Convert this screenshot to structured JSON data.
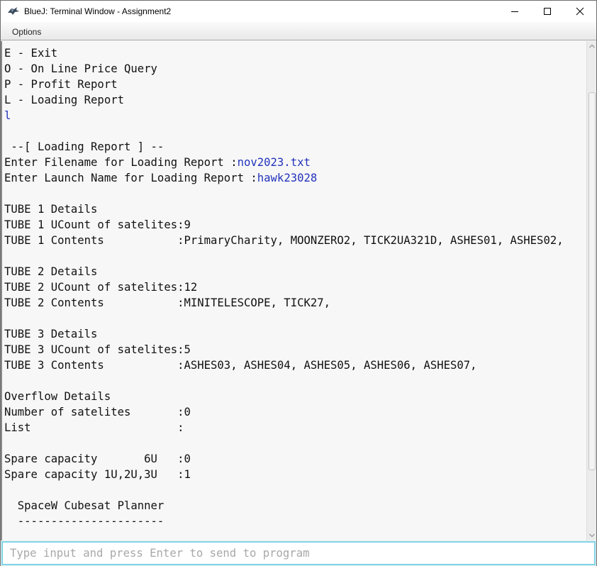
{
  "window": {
    "title": "BlueJ: Terminal Window - Assignment2",
    "app_icon": "bluej-bird-icon",
    "controls": [
      "minimize-icon",
      "maximize-icon",
      "close-icon"
    ]
  },
  "menubar": {
    "items": [
      {
        "label": "Options"
      }
    ]
  },
  "terminal": {
    "lines": [
      {
        "text": "E - Exit"
      },
      {
        "text": "O - On Line Price Query"
      },
      {
        "text": "P - Profit Report"
      },
      {
        "text": "L - Loading Report"
      },
      {
        "text": "",
        "input": "l"
      },
      {
        "text": ""
      },
      {
        "text": " --[ Loading Report ] --"
      },
      {
        "text": "Enter Filename for Loading Report :",
        "input": "nov2023.txt"
      },
      {
        "text": "Enter Launch Name for Loading Report :",
        "input": "hawk23028"
      },
      {
        "text": ""
      },
      {
        "text": "TUBE 1 Details"
      },
      {
        "text": "TUBE 1 UCount of satelites:9"
      },
      {
        "text": "TUBE 1 Contents           :PrimaryCharity, MOONZERO2, TICK2UA321D, ASHES01, ASHES02,"
      },
      {
        "text": ""
      },
      {
        "text": "TUBE 2 Details"
      },
      {
        "text": "TUBE 2 UCount of satelites:12"
      },
      {
        "text": "TUBE 2 Contents           :MINITELESCOPE, TICK27,"
      },
      {
        "text": ""
      },
      {
        "text": "TUBE 3 Details"
      },
      {
        "text": "TUBE 3 UCount of satelites:5"
      },
      {
        "text": "TUBE 3 Contents           :ASHES03, ASHES04, ASHES05, ASHES06, ASHES07,"
      },
      {
        "text": ""
      },
      {
        "text": "Overflow Details"
      },
      {
        "text": "Number of satelites       :0"
      },
      {
        "text": "List                      :"
      },
      {
        "text": ""
      },
      {
        "text": "Spare capacity       6U   :0"
      },
      {
        "text": "Spare capacity 1U,2U,3U   :1"
      },
      {
        "text": ""
      },
      {
        "text": "  SpaceW Cubesat Planner"
      },
      {
        "text": "  ----------------------"
      }
    ]
  },
  "input": {
    "value": "",
    "placeholder": "Type input and press Enter to send to program"
  },
  "colors": {
    "user_input": "#2233bb",
    "input_focus_border": "#7fd3e6",
    "terminal_bg": "#f7f7f7"
  }
}
